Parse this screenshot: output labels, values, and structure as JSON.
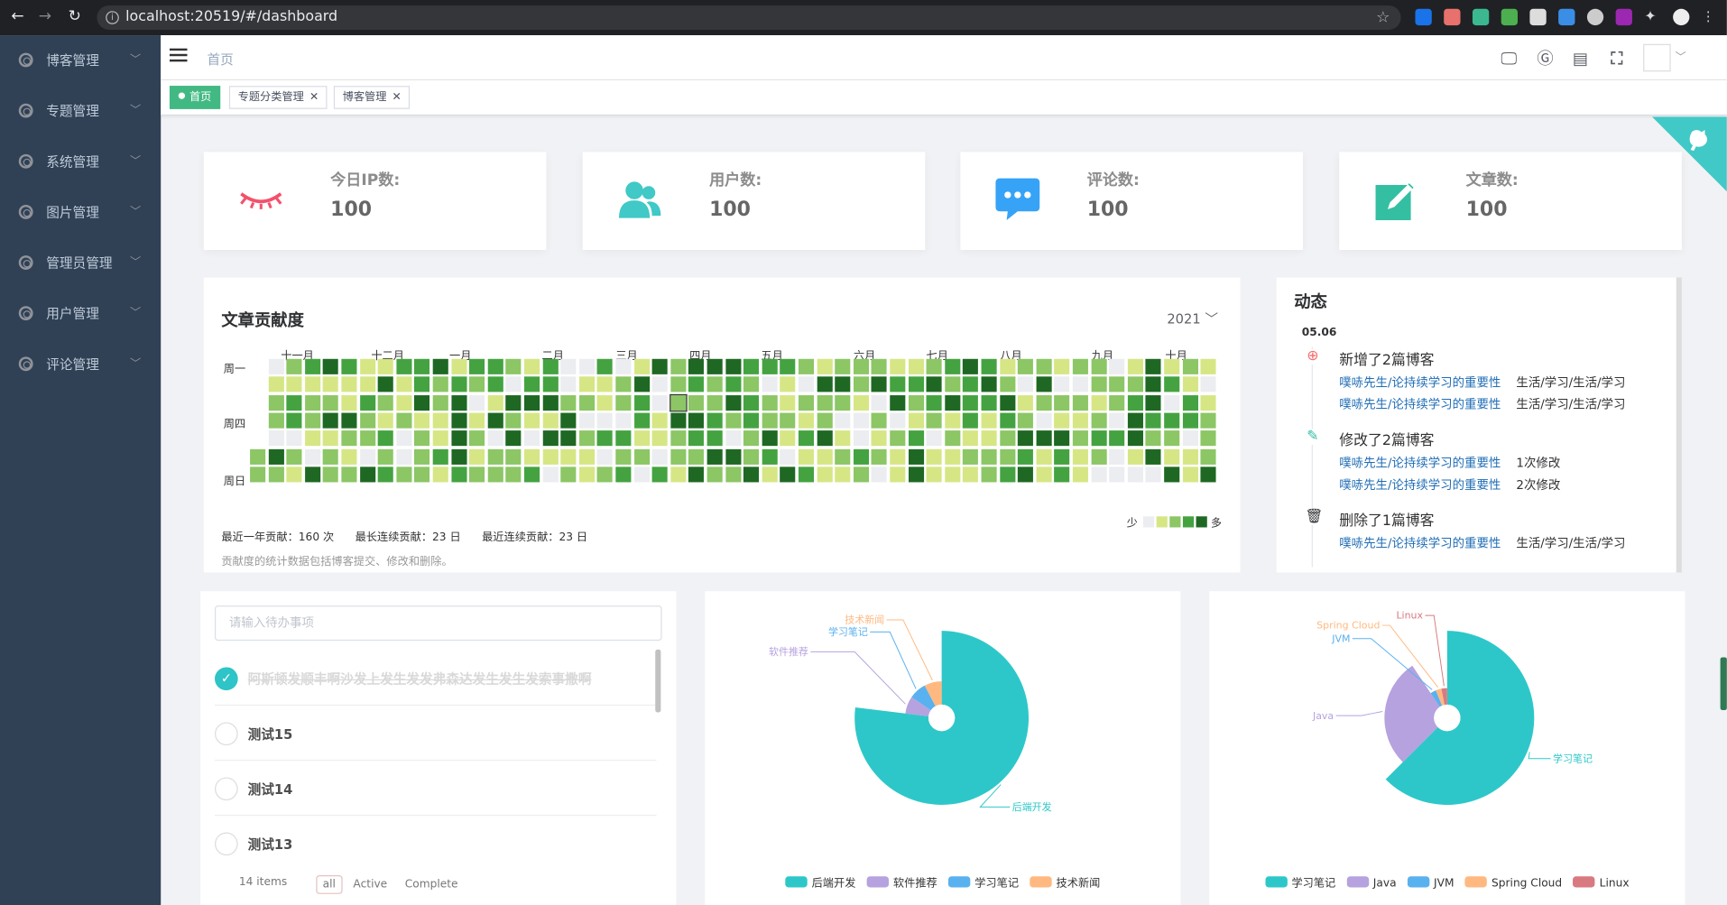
{
  "browser": {
    "url": "localhost:20519/#/dashboard"
  },
  "sidebar": {
    "items": [
      {
        "label": "博客管理"
      },
      {
        "label": "专题管理"
      },
      {
        "label": "系统管理"
      },
      {
        "label": "图片管理"
      },
      {
        "label": "管理员管理"
      },
      {
        "label": "用户管理"
      },
      {
        "label": "评论管理"
      }
    ]
  },
  "navbar": {
    "breadcrumb": "首页"
  },
  "tags": [
    {
      "label": "首页",
      "active": true
    },
    {
      "label": "专题分类管理",
      "active": false
    },
    {
      "label": "博客管理",
      "active": false
    }
  ],
  "stats": [
    {
      "label": "今日IP数:",
      "value": "100",
      "icon": "eye-closed-icon",
      "color": "#f4516c"
    },
    {
      "label": "用户数:",
      "value": "100",
      "icon": "users-icon",
      "color": "#40c9c6"
    },
    {
      "label": "评论数:",
      "value": "100",
      "icon": "message-icon",
      "color": "#36a3f7"
    },
    {
      "label": "文章数:",
      "value": "100",
      "icon": "edit-icon",
      "color": "#34bfa3"
    }
  ],
  "contribution": {
    "title": "文章贡献度",
    "year": "2021",
    "months": [
      "十一月",
      "十二月",
      "一月",
      "二月",
      "三月",
      "四月",
      "五月",
      "六月",
      "七月",
      "八月",
      "九月",
      "十月"
    ],
    "weekdays": [
      "周一",
      "周四",
      "周日"
    ],
    "legend_less": "少",
    "legend_more": "多",
    "colors": [
      "#ebedf0",
      "#d6e685",
      "#8cc665",
      "#44a340",
      "#1e6823"
    ],
    "stats": [
      "最近一年贡献：160 次",
      "最长连续贡献：23 日",
      "最近连续贡献：23 日"
    ],
    "note": "贡献度的统计数据包括博客提交、修改和删除。"
  },
  "activity": {
    "title": "动态",
    "date": "05.06",
    "groups": [
      {
        "icon": "add-circle-icon",
        "color": "#f56c6c",
        "title": "新增了2篇博客",
        "rows": [
          {
            "link": "噗哧先生/论持续学习的重要性",
            "info": "生活/学习/生活/学习"
          },
          {
            "link": "噗哧先生/论持续学习的重要性",
            "info": "生活/学习/生活/学习"
          }
        ]
      },
      {
        "icon": "edit-icon",
        "color": "#34bfa3",
        "title": "修改了2篇博客",
        "rows": [
          {
            "link": "噗哧先生/论持续学习的重要性",
            "info": "1次修改"
          },
          {
            "link": "噗哧先生/论持续学习的重要性",
            "info": "2次修改"
          }
        ]
      },
      {
        "icon": "trash-icon",
        "color": "#303133",
        "title": "删除了1篇博客",
        "rows": [
          {
            "link": "噗哧先生/论持续学习的重要性",
            "info": "生活/学习/生活/学习"
          }
        ]
      }
    ]
  },
  "todo": {
    "placeholder": "请输入待办事项",
    "items": [
      {
        "text": "阿斯顿发顺丰啊沙发上发生发发弗森达发生发生发索事撒啊",
        "done": true
      },
      {
        "text": "测试15",
        "done": false
      },
      {
        "text": "测试14",
        "done": false
      },
      {
        "text": "测试13",
        "done": false
      }
    ],
    "count": "14 items",
    "filters": [
      "all",
      "Active",
      "Complete"
    ],
    "selected_filter": "all"
  },
  "chart_data": [
    {
      "type": "pie",
      "variant": "nightingale-rose",
      "categories": [
        "后端开发",
        "软件推荐",
        "学习笔记",
        "技术新闻"
      ],
      "values": [
        1,
        0.1,
        0.1,
        0.1
      ],
      "colors": [
        "#2ec7c9",
        "#b6a2de",
        "#5ab1ef",
        "#ffb980"
      ],
      "legend": "bottom"
    },
    {
      "type": "pie",
      "variant": "nightingale-rose",
      "categories": [
        "学习笔记",
        "Java",
        "JVM",
        "Spring Cloud",
        "Linux"
      ],
      "values": [
        1,
        0.45,
        0.05,
        0.05,
        0.05
      ],
      "colors": [
        "#2ec7c9",
        "#b6a2de",
        "#5ab1ef",
        "#ffb980",
        "#d87a80"
      ],
      "legend": "bottom"
    }
  ]
}
